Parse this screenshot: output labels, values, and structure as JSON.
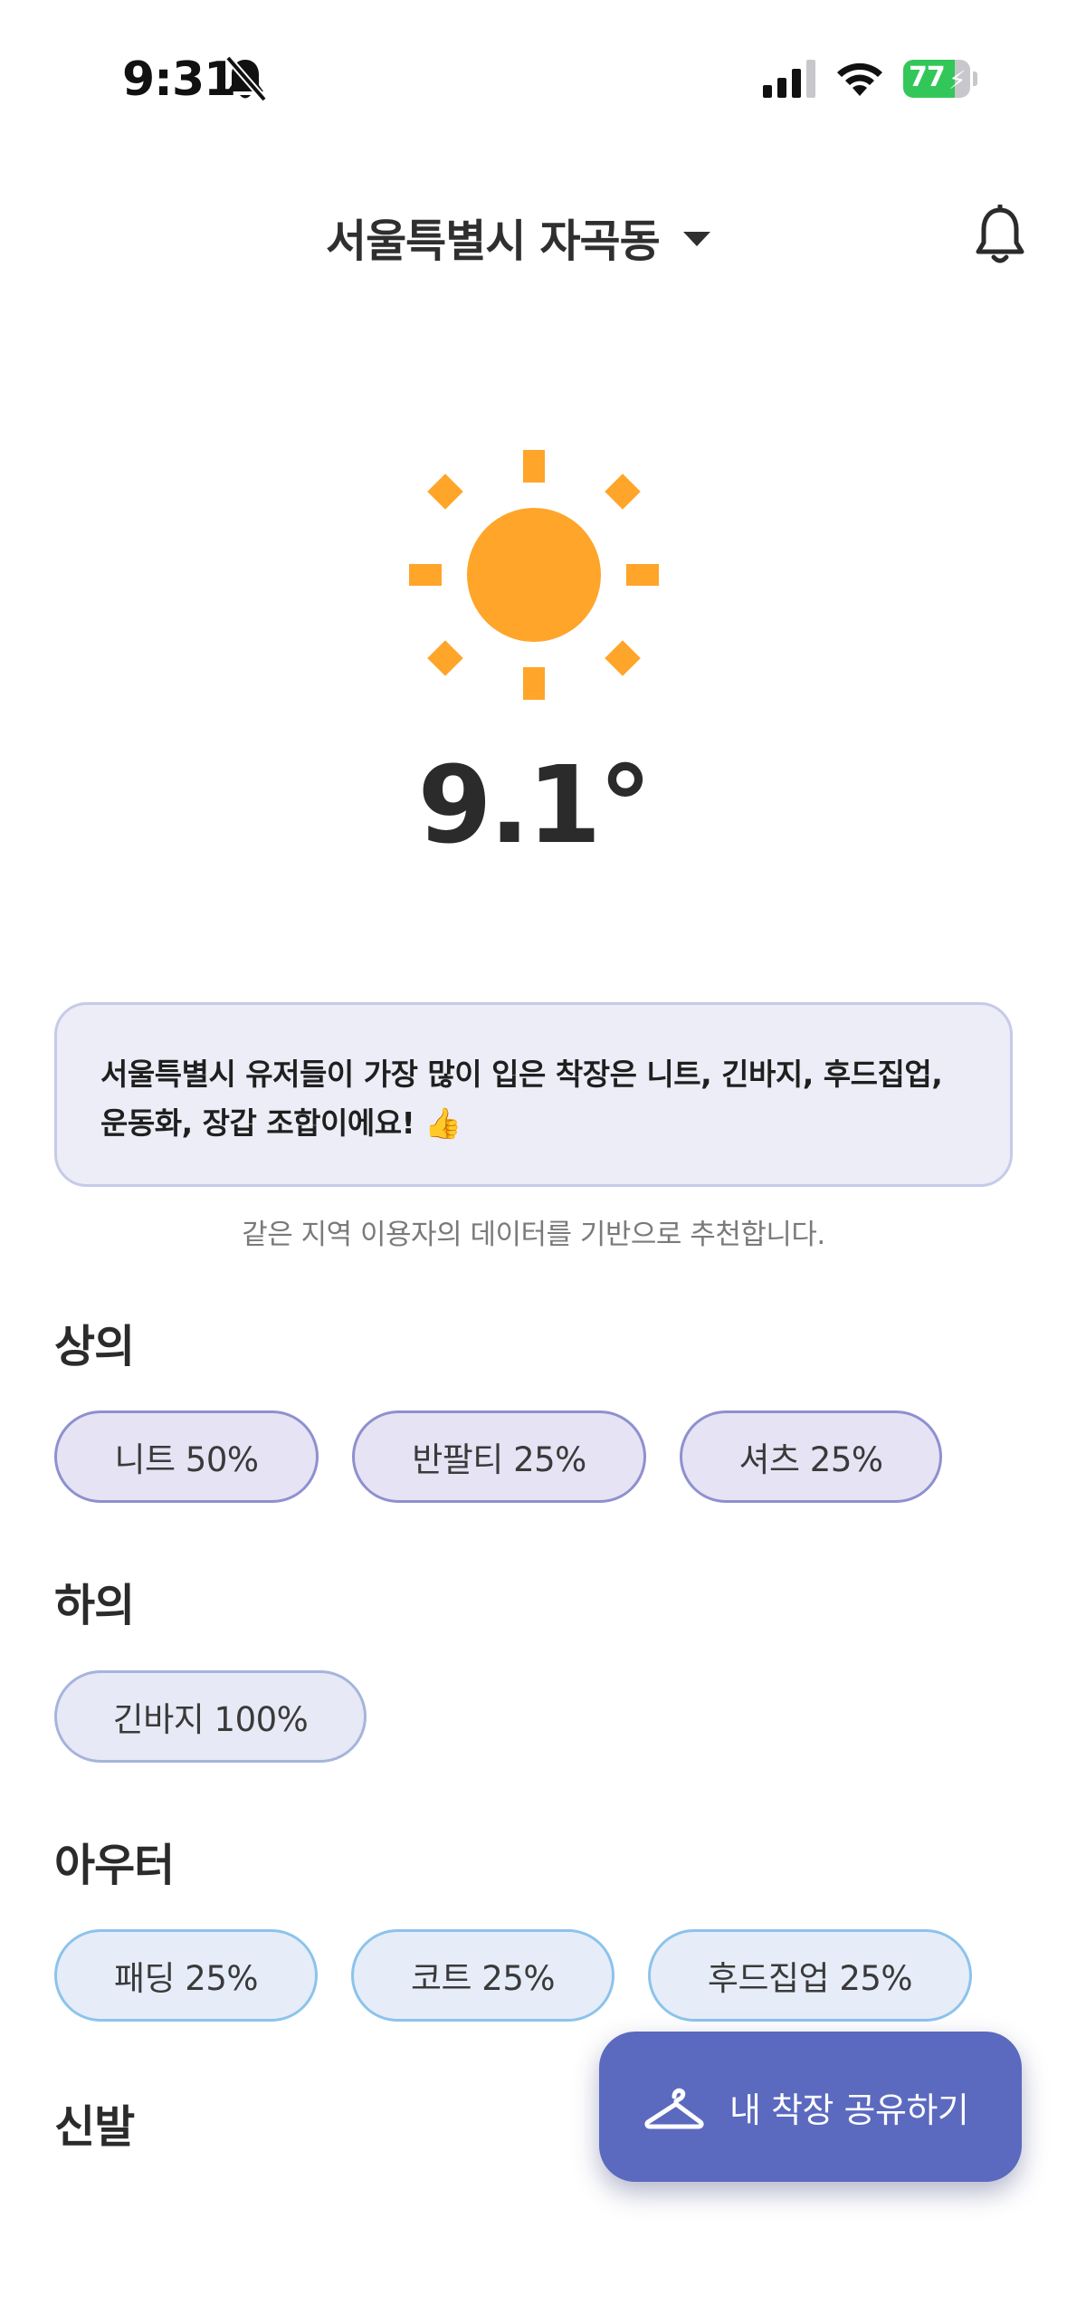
{
  "status_bar": {
    "time": "9:31",
    "battery_level": "77",
    "battery_fraction": 0.77,
    "battery_color": "#33c759"
  },
  "header": {
    "location": "서울특별시 자곡동",
    "location_icon": "chevron-down-icon",
    "notification_icon": "bell-icon"
  },
  "weather": {
    "icon": "sun-icon",
    "temperature": "9.1°",
    "sun_color": "#ffa52a"
  },
  "recommendation": {
    "message": "서울특별시 유저들이 가장 많이 입은 착장은 니트, 긴바지, 후드집업, 운동화, 장갑 조합이에요! 👍",
    "note": "같은 지역 이용자의 데이터를 기반으로 추천합니다."
  },
  "sections": {
    "tops": {
      "title": "상의",
      "chips": [
        {
          "label": "니트 50%"
        },
        {
          "label": "반팔티 25%"
        },
        {
          "label": "셔츠 25%"
        }
      ]
    },
    "bottoms": {
      "title": "하의",
      "chips": [
        {
          "label": "긴바지 100%"
        }
      ]
    },
    "outer": {
      "title": "아우터",
      "chips": [
        {
          "label": "패딩 25%"
        },
        {
          "label": "코트 25%"
        },
        {
          "label": "후드집업 25%"
        }
      ]
    },
    "shoes": {
      "title": "신발"
    }
  },
  "fab": {
    "label": "내 착장 공유하기",
    "icon": "hanger-icon",
    "color": "#5b69bf"
  }
}
